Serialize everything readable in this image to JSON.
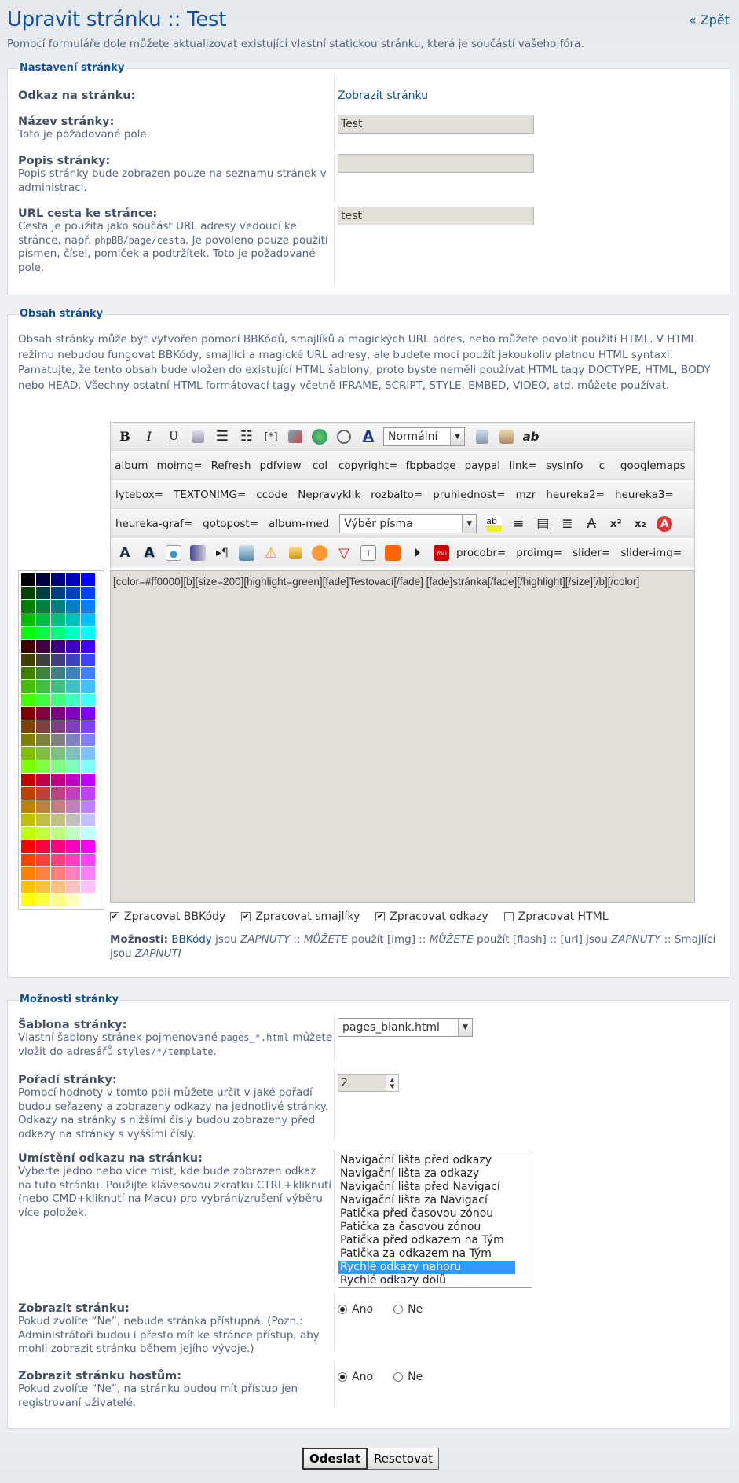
{
  "header": {
    "title": "Upravit stránku :: Test",
    "intro": "Pomocí formuláře dole můžete aktualizovat existující vlastní statickou stránku, která je součástí vašeho fóra.",
    "back": "« Zpět"
  },
  "settings": {
    "legend": "Nastavení stránky",
    "link_label": "Odkaz na stránku:",
    "link_value": "Zobrazit stránku",
    "name_label": "Název stránky:",
    "name_explain": "Toto je požadované pole.",
    "name_value": "Test",
    "desc_label": "Popis stránky:",
    "desc_explain": "Popis stránky bude zobrazen pouze na seznamu stránek v administraci.",
    "desc_value": "",
    "url_label": "URL cesta ke stránce:",
    "url_explain_1": "Cesta je použita jako součást URL adresy vedoucí ke stránce, např.",
    "url_explain_code": "phpBB/page/cesta",
    "url_explain_2": ". Je povoleno pouze použití písmen, čísel, pomlček a podtržítek. Toto je požadované pole.",
    "url_value": "test"
  },
  "content": {
    "legend": "Obsah stránky",
    "intro": "Obsah stránky může být vytvořen pomocí BBKódů, smajlíků a magických URL adres, nebo můžete povolit použití HTML. V HTML režimu nebudou fungovat BBKódy, smajlíci a magické URL adresy, ale budete moci použít jakoukoliv platnou HTML syntaxi. Pamatujte, že tento obsah bude vložen do existující HTML šablony, proto byste neměli používat HTML tagy DOCTYPE, HTML, BODY nebo HEAD. Všechny ostatní HTML formátovací tagy včetně IFRAME, SCRIPT, STYLE, EMBED, VIDEO, atd. můžete používat.",
    "toolbar": {
      "bold": "B",
      "italic": "I",
      "underline": "U",
      "code": "[*]",
      "size_select": "Normální",
      "font_select": "Výběr písma",
      "row2": [
        "album",
        "moimg=",
        "Refresh",
        "pdfview",
        "col",
        "copyright=",
        "fbpbadge",
        "paypal",
        "link=",
        "sysinfo",
        "c",
        "googlemaps"
      ],
      "row3": [
        "lytebox=",
        "TEXTONIMG=",
        "ccode",
        "Nepravyklik",
        "rozbalto=",
        "pruhlednost=",
        "mzr",
        "heureka2=",
        "heureka3="
      ],
      "row4": [
        "heureka-graf=",
        "gotopost=",
        "album-med"
      ],
      "row5": [
        "procobr=",
        "proimg=",
        "slider=",
        "slider-img="
      ]
    },
    "editor_text": "[color=#ff0000][b][size=200][highlight=green][fade]Testovací[/fade] [fade]stránka[/fade][/highlight][/size][/b][/color]",
    "checks": [
      {
        "label": "Zpracovat BBKódy",
        "checked": true
      },
      {
        "label": "Zpracovat smajlíky",
        "checked": true
      },
      {
        "label": "Zpracovat odkazy",
        "checked": true
      },
      {
        "label": "Zpracovat HTML",
        "checked": false
      }
    ],
    "options": {
      "prefix": "Možnosti:",
      "bbcode_link": "BBKódy",
      "t1": "jsou",
      "on1": "ZAPNUTY",
      "t2": "::",
      "can1": "MŮŽETE",
      "t3": "použít [img] ::",
      "can2": "MŮŽETE",
      "t4": "použít [flash] :: [url] jsou",
      "on2": "ZAPNUTY",
      "t5": ":: Smajlíci jsou",
      "on3": "ZAPNUTI"
    }
  },
  "page_options": {
    "legend": "Možnosti stránky",
    "template_label": "Šablona stránky:",
    "template_explain_1": "Vlastní šablony stránek pojmenované",
    "template_explain_code1": "pages_*.html",
    "template_explain_2": "můžete vložit do adresářů",
    "template_explain_code2": "styles/*/template",
    "template_explain_3": ".",
    "template_value": "pages_blank.html",
    "order_label": "Pořadí stránky:",
    "order_explain": "Pomocí hodnoty v tomto poli můžete určit v jaké pořadí budou seřazeny a zobrazeny odkazy na jednotlivé stránky. Odkazy na stránky s nižšími čísly budou zobrazeny před odkazy na stránky s vyššími čísly.",
    "order_value": "2",
    "location_label": "Umístění odkazu na stránku:",
    "location_explain": "Vyberte jedno nebo více míst, kde bude zobrazen odkaz na tuto stránku. Použijte klávesovou zkratku CTRL+kliknutí (nebo CMD+kliknutí na Macu) pro vybrání/zrušení výběru více položek.",
    "locations": [
      "Navigační lišta před odkazy",
      "Navigační lišta za odkazy",
      "Navigační lišta před Navigací",
      "Navigační lišta za Navigací",
      "Patička před časovou zónou",
      "Patička za časovou zónou",
      "Patička před odkazem na Tým",
      "Patička za odkazem na Tým",
      "Rychlé odkazy nahoru",
      "Rychlé odkazy dolů"
    ],
    "location_selected": "Rychlé odkazy nahoru",
    "show_label": "Zobrazit stránku:",
    "show_explain": "Pokud zvolíte “Ne”, nebude stránka přístupná. (Pozn.: Administrátoři budou i přesto mít ke stránce přístup, aby mohli zobrazit stránku během jejího vývoje.)",
    "guest_label": "Zobrazit stránku hostům:",
    "guest_explain": "Pokud zvolíte “Ne”, na stránku budou mít přístup jen registrovaní uživatelé.",
    "yes": "Ano",
    "no": "Ne",
    "show_value": "Ano",
    "guest_value": "Ano"
  },
  "buttons": {
    "submit": "Odeslat",
    "reset": "Resetovat"
  },
  "colors": {
    "link": "#105289",
    "title": "#115098",
    "input_bg": "#e2dfd8",
    "selected": "#3399ff"
  }
}
